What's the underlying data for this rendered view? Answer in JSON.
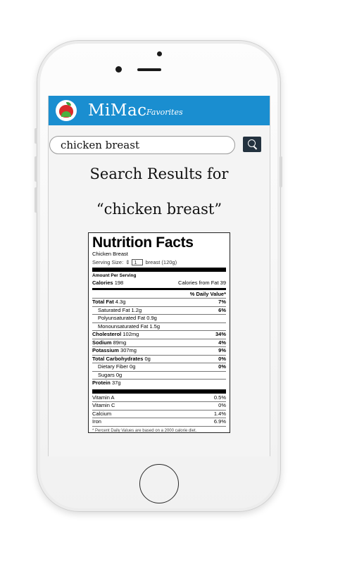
{
  "app": {
    "name": "MiMac",
    "nav_favorites": "Favorites"
  },
  "search": {
    "value": "chicken breast",
    "button_icon": "search-icon"
  },
  "results": {
    "heading_line1": "Search Results for",
    "heading_line2": "“chicken breast”"
  },
  "nutrition": {
    "title": "Nutrition Facts",
    "food": "Chicken Breast",
    "serving_label": "Serving Size:",
    "serving_qty": "1",
    "serving_unit": "breast  (120g)",
    "amount_per_serving": "Amount Per Serving",
    "calories_label": "Calories",
    "calories_value": "198",
    "calories_fat": "Calories from Fat 39",
    "dv_header": "% Daily Value*",
    "nutrients": [
      {
        "label": "Total Fat",
        "amount": "4.3g",
        "dv": "7%"
      },
      {
        "label": "Saturated Fat",
        "amount": "1.2g",
        "dv": "6%"
      },
      {
        "label": "Polyunsaturated Fat",
        "amount": "0.9g",
        "dv": ""
      },
      {
        "label": "Monounsaturated Fat",
        "amount": "1.5g",
        "dv": ""
      },
      {
        "label": "Cholesterol",
        "amount": "102mg",
        "dv": "34%"
      },
      {
        "label": "Sodium",
        "amount": "89mg",
        "dv": "4%"
      },
      {
        "label": "Potassium",
        "amount": "307mg",
        "dv": "9%"
      },
      {
        "label": "Total Carbohydrates",
        "amount": "0g",
        "dv": "0%"
      },
      {
        "label": "Dietary Fiber",
        "amount": "0g",
        "dv": "0%"
      },
      {
        "label": "Sugars",
        "amount": "0g",
        "dv": ""
      },
      {
        "label": "Protein",
        "amount": "37g",
        "dv": ""
      }
    ],
    "vitamins": [
      {
        "label": "Vitamin A",
        "dv": "0.5%"
      },
      {
        "label": "Vitamin C",
        "dv": "0%"
      },
      {
        "label": "Calcium",
        "dv": "1.4%"
      },
      {
        "label": "Iron",
        "dv": "6.9%"
      }
    ],
    "footnote": "* Percent Daily Values are based on a 2000 calorie diet."
  },
  "colors": {
    "appbar": "#1a8ed0",
    "search_button": "#23323f"
  }
}
